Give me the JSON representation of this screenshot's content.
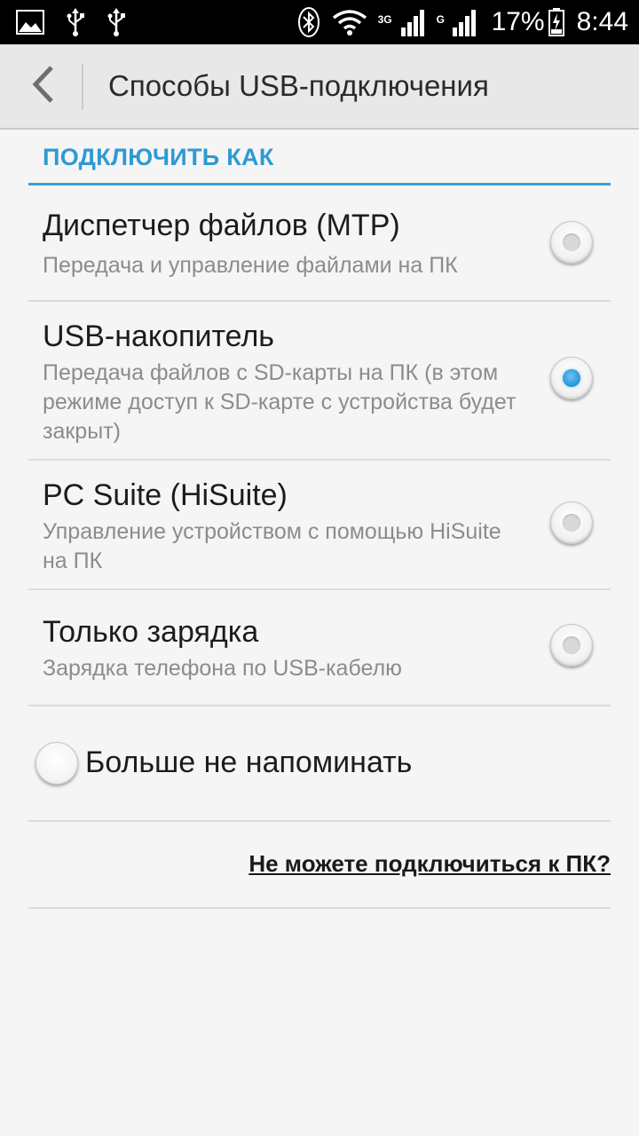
{
  "status_bar": {
    "left_icons": [
      "image-icon",
      "usb-icon",
      "usb-icon"
    ],
    "right_icons": [
      "bluetooth-icon",
      "wifi-icon",
      "signal-3g-icon",
      "signal-g-icon",
      "battery-charging-icon"
    ],
    "network_label_1": "3G",
    "network_label_2": "G",
    "battery_percent": "17%",
    "time": "8:44"
  },
  "action_bar": {
    "title": "Способы USB-подключения",
    "back_icon": "chevron-left-icon"
  },
  "section": {
    "header": "ПОДКЛЮЧИТЬ КАК"
  },
  "options": [
    {
      "title": "Диспетчер файлов (MTP)",
      "description": "Передача и управление файлами на ПК",
      "selected": false
    },
    {
      "title": "USB-накопитель",
      "description": "Передача файлов с SD-карты на ПК (в этом режиме доступ к SD-карте с устройства будет закрыт)",
      "selected": true
    },
    {
      "title": "PC Suite (HiSuite)",
      "description": "Управление устройством с помощью HiSuite на ПК",
      "selected": false
    },
    {
      "title": "Только зарядка",
      "description": "Зарядка телефона по USB-кабелю",
      "selected": false
    }
  ],
  "remind": {
    "label": "Больше не напоминать",
    "checked": false
  },
  "help": {
    "link": "Не можете подключиться к ПК?"
  },
  "colors": {
    "accent": "#2e9ad3",
    "status_bar_bg": "#000000",
    "action_bar_bg": "#e8e8e8",
    "page_bg": "#f5f5f5"
  }
}
